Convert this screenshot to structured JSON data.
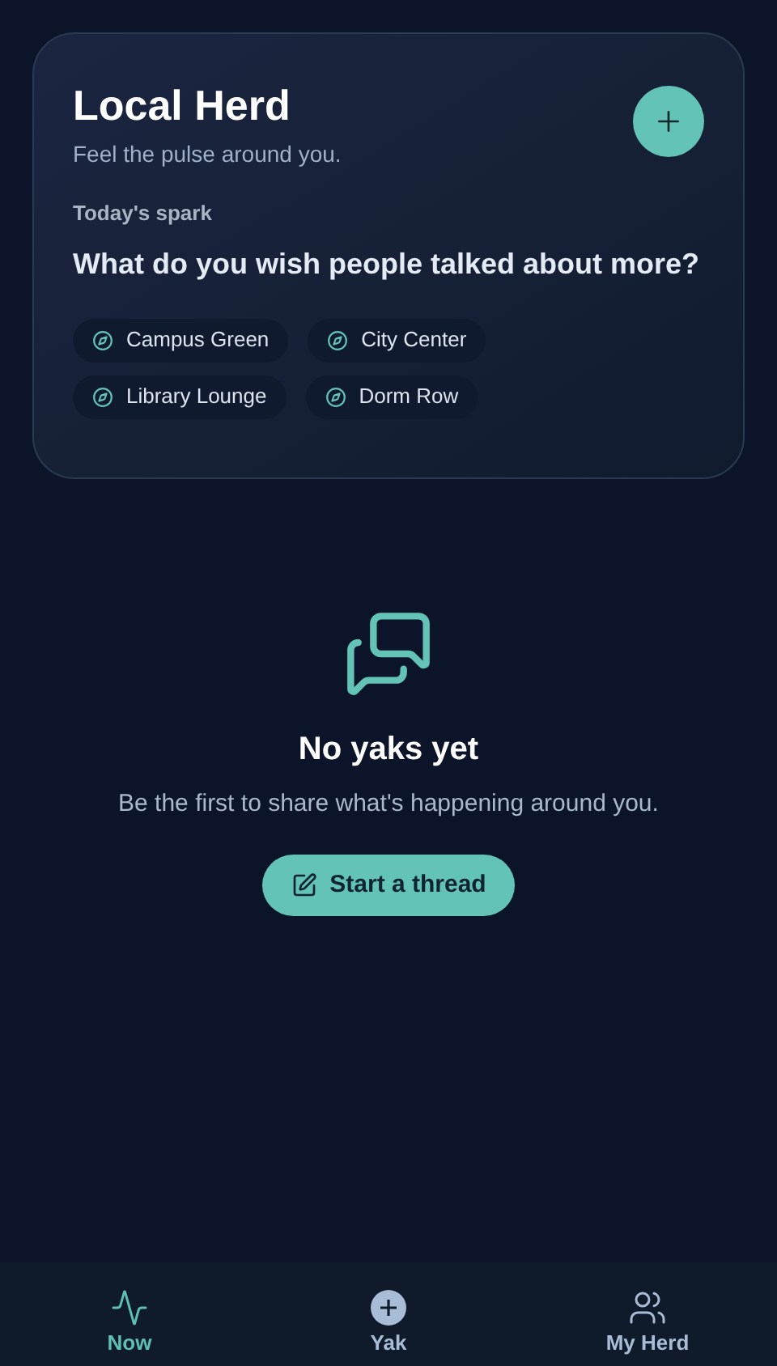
{
  "header": {
    "title": "Local Herd",
    "subtitle": "Feel the pulse around you."
  },
  "spark": {
    "label": "Today's spark",
    "question": "What do you wish people talked about more?"
  },
  "places": [
    "Campus Green",
    "City Center",
    "Library Lounge",
    "Dorm Row"
  ],
  "empty_state": {
    "title": "No yaks yet",
    "message": "Be the first to share what's happening around you.",
    "button": "Start a thread"
  },
  "tabs": [
    {
      "label": "Now",
      "kind": "pulse",
      "selected": true
    },
    {
      "label": "Yak",
      "kind": "add",
      "selected": false
    },
    {
      "label": "My Herd",
      "kind": "people",
      "selected": false
    }
  ]
}
